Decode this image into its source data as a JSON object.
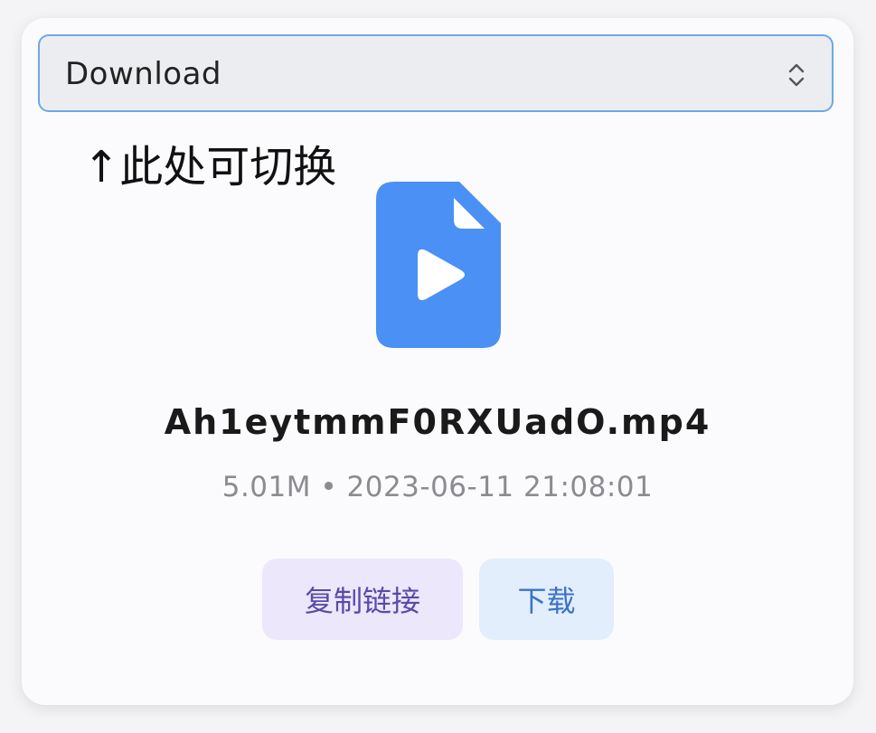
{
  "dropdown": {
    "selected": "Download",
    "icon": "chevron-up-down-icon"
  },
  "hint": {
    "text": "↑此处可切换"
  },
  "file": {
    "icon": "video-file-icon",
    "icon_color": "#4a90f5",
    "name": "Ah1eytmmF0RXUadO.mp4",
    "meta": "5.01M • 2023-06-11 21:08:01"
  },
  "actions": {
    "copy_label": "复制链接",
    "download_label": "下载"
  },
  "colors": {
    "accent_border": "#6ea8e6",
    "copy_bg": "#ece7fb",
    "copy_text": "#5a4aa8",
    "download_bg": "#e2eefc",
    "download_text": "#3b73c8"
  }
}
